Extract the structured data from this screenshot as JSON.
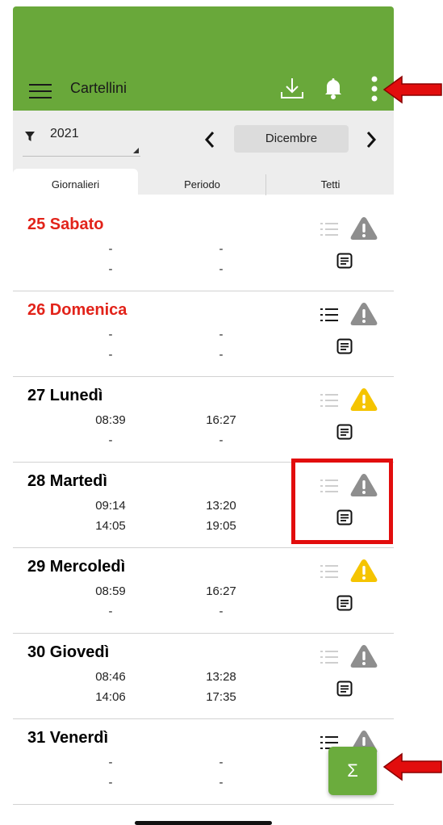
{
  "colors": {
    "appbar": "#69a83a",
    "weekend": "#e2231a",
    "warn_yellow": "#f5c400",
    "warn_grey": "#8e8e8e",
    "annotation_red": "#e20d0d"
  },
  "header": {
    "title": "Cartellini",
    "icons": [
      "menu-icon",
      "download-icon",
      "bell-icon",
      "more-vertical-icon"
    ]
  },
  "filter": {
    "year": "2021",
    "month": "Dicembre"
  },
  "tabs": [
    {
      "label": "Giornalieri",
      "active": true
    },
    {
      "label": "Periodo"
    },
    {
      "label": "Tetti"
    }
  ],
  "days": [
    {
      "label": "25 Sabato",
      "weekend": true,
      "times": [
        "-",
        "-",
        "-",
        "-"
      ],
      "list_active": false,
      "warning": "grey"
    },
    {
      "label": "26 Domenica",
      "weekend": true,
      "times": [
        "-",
        "-",
        "-",
        "-"
      ],
      "list_active": true,
      "warning": "grey"
    },
    {
      "label": "27 Lunedì",
      "weekend": false,
      "times": [
        "08:39",
        "16:27",
        "-",
        "-"
      ],
      "list_active": false,
      "warning": "yellow"
    },
    {
      "label": "28 Martedì",
      "weekend": false,
      "times": [
        "09:14",
        "13:20",
        "14:05",
        "19:05"
      ],
      "list_active": false,
      "warning": "grey"
    },
    {
      "label": "29 Mercoledì",
      "weekend": false,
      "times": [
        "08:59",
        "16:27",
        "-",
        "-"
      ],
      "list_active": false,
      "warning": "yellow"
    },
    {
      "label": "30 Giovedì",
      "weekend": false,
      "times": [
        "08:46",
        "13:28",
        "14:06",
        "17:35"
      ],
      "list_active": false,
      "warning": "grey"
    },
    {
      "label": "31 Venerdì",
      "weekend": false,
      "times": [
        "-",
        "-",
        "-",
        "-"
      ],
      "list_active": true,
      "warning": "grey"
    }
  ],
  "fab": {
    "label": "Σ"
  }
}
